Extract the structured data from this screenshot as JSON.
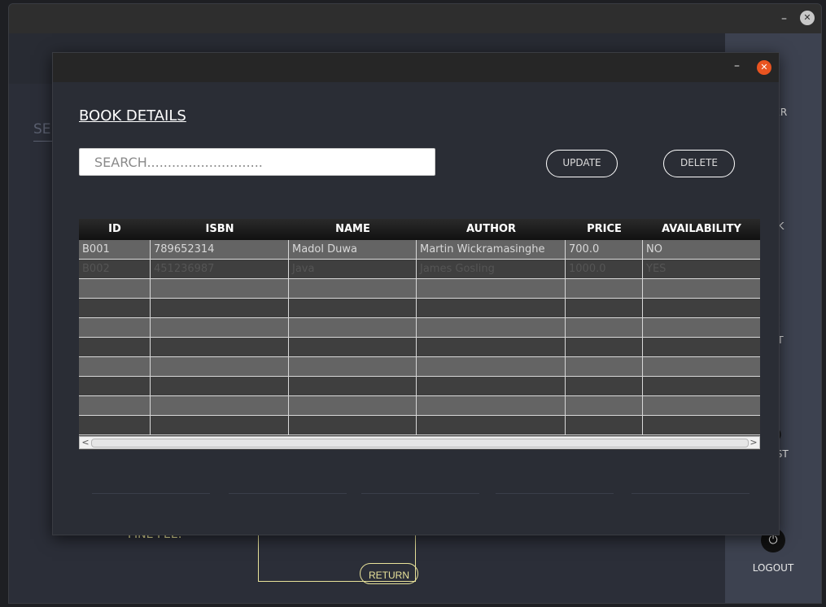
{
  "outer_window": {
    "minimize_glyph": "–",
    "close_glyph": "✕",
    "background": {
      "search_label": "SE",
      "fine_fee_label": "FINE FEE:",
      "return_button": "RETURN"
    },
    "sidebar": {
      "items": [
        {
          "label": "MBER",
          "icon": "add-member-icon"
        },
        {
          "label": "OOK",
          "icon": "add-book-icon"
        },
        {
          "label": "LIST",
          "icon": "book-list-icon"
        },
        {
          "label": "R LIST",
          "icon": "member-list-icon"
        },
        {
          "label": "LOGOUT",
          "icon": "logout-icon"
        }
      ]
    }
  },
  "dialog": {
    "minimize_glyph": "–",
    "close_glyph": "✕",
    "title": "BOOK DETAILS",
    "search": {
      "placeholder": "SEARCH............................",
      "value": ""
    },
    "update_button": "UPDATE",
    "delete_button": "DELETE",
    "table": {
      "columns": [
        "ID",
        "ISBN",
        "NAME",
        "AUTHOR",
        "PRICE",
        "AVAILABILITY"
      ],
      "rows": [
        [
          "B001",
          "789652314",
          "Madol Duwa",
          "Martin Wickramasinghe",
          "700.0",
          "NO"
        ],
        [
          "B002",
          "451236987",
          "Java",
          "James Gosling",
          "1000.0",
          "YES"
        ]
      ],
      "empty_rows": 8
    },
    "scrollbar": {
      "left_arrow": "<",
      "right_arrow": ">"
    }
  },
  "colors": {
    "accent_close": "#e95420",
    "header_bg": "#111111",
    "row_light": "#646464",
    "row_dark": "#3f3f3f",
    "yellow_accent": "#e8e29a"
  }
}
